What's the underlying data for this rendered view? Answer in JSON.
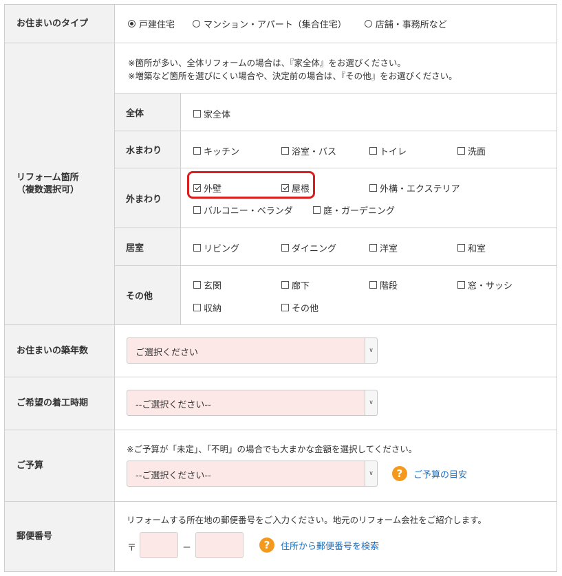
{
  "housing_type": {
    "label": "お住まいのタイプ",
    "options": [
      {
        "label": "戸建住宅",
        "selected": true
      },
      {
        "label": "マンション・アパート（集合住宅）",
        "selected": false
      },
      {
        "label": "店舗・事務所など",
        "selected": false
      }
    ]
  },
  "reform_location": {
    "label_line1": "リフォーム箇所",
    "label_line2": "（複数選択可）",
    "note1": "※箇所が多い、全体リフォームの場合は、『家全体』をお選びください。",
    "note2": "※増築など箇所を選びにくい場合や、決定前の場合は、『その他』をお選びください。",
    "categories": [
      {
        "label": "全体",
        "items": [
          {
            "label": "家全体",
            "checked": false
          }
        ]
      },
      {
        "label": "水まわり",
        "items": [
          {
            "label": "キッチン",
            "checked": false
          },
          {
            "label": "浴室・バス",
            "checked": false
          },
          {
            "label": "トイレ",
            "checked": false
          },
          {
            "label": "洗面",
            "checked": false
          }
        ]
      },
      {
        "label": "外まわり",
        "items": [
          {
            "label": "外壁",
            "checked": true
          },
          {
            "label": "屋根",
            "checked": true
          },
          {
            "label": "外構・エクステリア",
            "checked": false
          },
          {
            "label": "バルコニー・ベランダ",
            "checked": false
          },
          {
            "label": "庭・ガーデニング",
            "checked": false
          }
        ]
      },
      {
        "label": "居室",
        "items": [
          {
            "label": "リビング",
            "checked": false
          },
          {
            "label": "ダイニング",
            "checked": false
          },
          {
            "label": "洋室",
            "checked": false
          },
          {
            "label": "和室",
            "checked": false
          }
        ]
      },
      {
        "label": "その他",
        "items": [
          {
            "label": "玄関",
            "checked": false
          },
          {
            "label": "廊下",
            "checked": false
          },
          {
            "label": "階段",
            "checked": false
          },
          {
            "label": "窓・サッシ",
            "checked": false
          },
          {
            "label": "収納",
            "checked": false
          },
          {
            "label": "その他",
            "checked": false
          }
        ]
      }
    ]
  },
  "building_age": {
    "label": "お住まいの築年数",
    "selected": "ご選択ください"
  },
  "start_time": {
    "label": "ご希望の着工時期",
    "selected": "--ご選択ください--"
  },
  "budget": {
    "label": "ご予算",
    "note": "※ご予算が「未定」、「不明」の場合でも大まかな金額を選択してください。",
    "selected": "--ご選択ください--",
    "help_link": "ご予算の目安"
  },
  "postal_code": {
    "label": "郵便番号",
    "note": "リフォームする所在地の郵便番号をご入力ください。地元のリフォーム会社をご紹介します。",
    "prefix": "〒",
    "separator": "－",
    "help_link": "住所から郵便番号を検索"
  },
  "colors": {
    "highlight": "#d81e1e",
    "input_bg": "#fde8e8",
    "help_icon": "#f39a1e",
    "link": "#1a6fc4"
  }
}
